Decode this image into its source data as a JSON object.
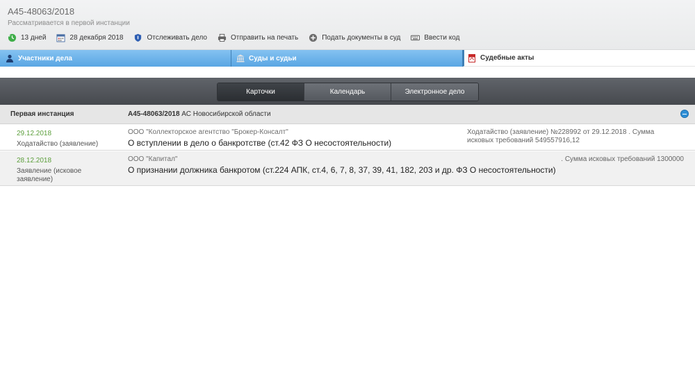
{
  "header": {
    "case_number": "А45-48063/2018",
    "status": "Рассматривается в первой инстанции",
    "toolbar": [
      {
        "label": "13 дней",
        "icon": "clock-back-icon"
      },
      {
        "label": "28 декабря 2018",
        "icon": "calendar-icon"
      },
      {
        "label": "Отслеживать дело",
        "icon": "shield-icon"
      },
      {
        "label": "Отправить на печать",
        "icon": "printer-icon"
      },
      {
        "label": "Подать документы в суд",
        "icon": "plus-circle-icon"
      },
      {
        "label": "Ввести код",
        "icon": "keyboard-icon"
      }
    ]
  },
  "tabs": [
    {
      "label": "Участники дела",
      "icon": "person-icon"
    },
    {
      "label": "Суды и судьи",
      "icon": "court-icon"
    },
    {
      "label": "Судебные акты",
      "icon": "pdf-icon"
    }
  ],
  "view_switch": {
    "options": [
      "Карточки",
      "Календарь",
      "Электронное дело"
    ],
    "active": "Карточки"
  },
  "instance": {
    "title": "Первая инстанция",
    "case_number": "А45-48063/2018",
    "court": "АС Новосибирской области"
  },
  "documents": [
    {
      "date": "29.12.2018",
      "type": "Ходатайство (заявление)",
      "party": "ООО \"Коллекторское агентство \"Брокер-Консалт\"",
      "title": "О вступлении в дело о банкротстве (ст.42 ФЗ О несостоятельности)",
      "note": "Ходатайство (заявление) №228992 от 29.12.2018 . Сумма исковых требований 549557916,12"
    },
    {
      "date": "28.12.2018",
      "type": "Заявление (исковое заявление)",
      "party": "ООО \"Капитал\"",
      "title": "О признании должника банкротом (ст.224 АПК, ст.4, 6, 7, 8, 37, 39, 41, 182, 203 и др. ФЗ О несостоятельности)",
      "note": ". Сумма исковых требований 1300000"
    }
  ],
  "colors": {
    "tab_blue": "#5aa6e3",
    "date_green": "#5b9e3a",
    "dark_bar": "#46494e"
  }
}
